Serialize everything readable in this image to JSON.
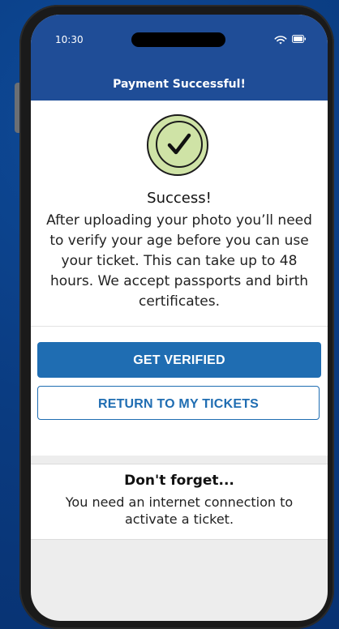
{
  "status_bar": {
    "time": "10:30"
  },
  "header": {
    "title": "Payment Successful!"
  },
  "success": {
    "title": "Success!",
    "message": "After uploading your photo you’ll need to verify your age before you can use your ticket. This can take up to 48 hours. We accept passports and birth certificates."
  },
  "actions": {
    "primary_label": "GET VERIFIED",
    "secondary_label": "RETURN TO MY TICKETS"
  },
  "reminder": {
    "title": "Don't forget...",
    "message": "You need an internet connection to activate a ticket."
  },
  "icons": {
    "status": [
      "wifi-icon",
      "battery-icon"
    ],
    "success": "checkmark-circle-icon"
  },
  "colors": {
    "brand_blue": "#1f4d97",
    "button_blue": "#1f6db2",
    "success_green": "#cfe3a6",
    "background_blue": "#0b3f86"
  }
}
